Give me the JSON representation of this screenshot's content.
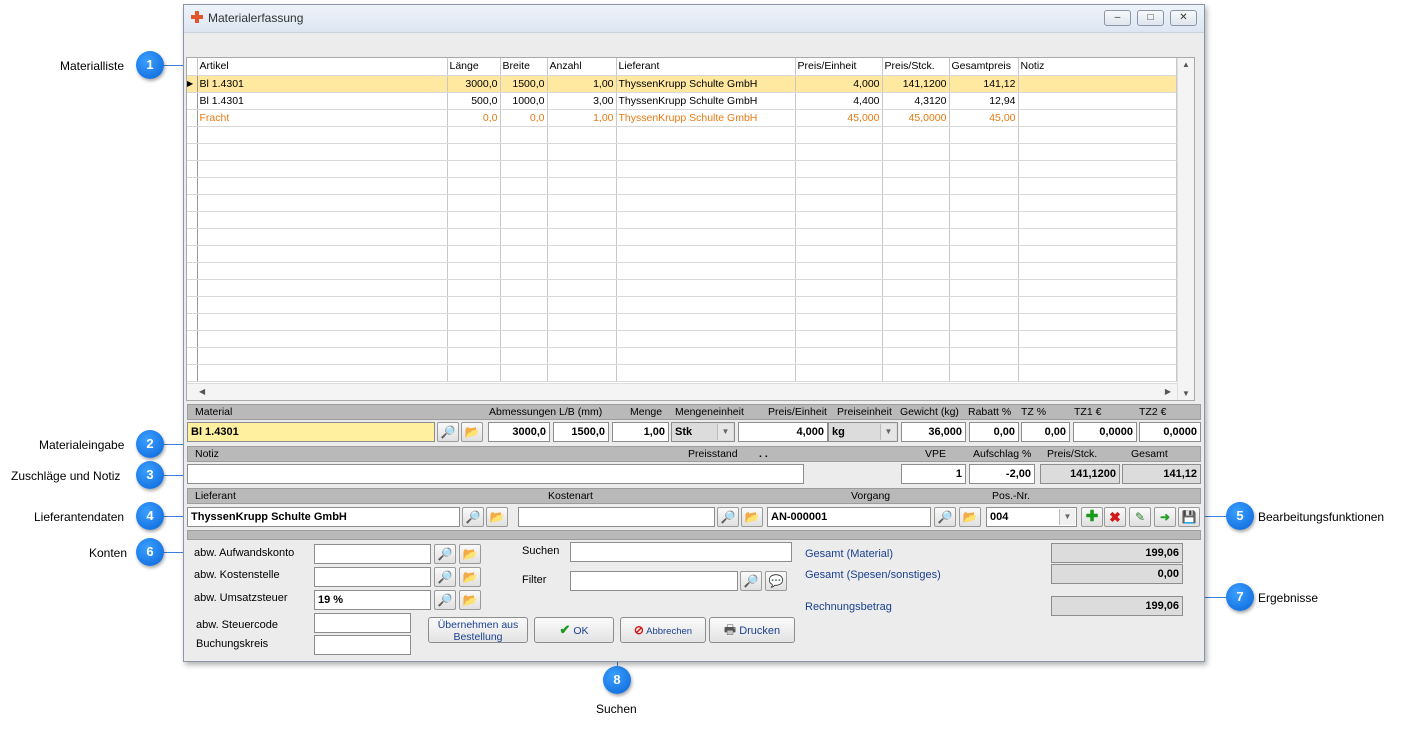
{
  "callouts": {
    "c1": {
      "num": "1",
      "label": "Materialliste"
    },
    "c2": {
      "num": "2",
      "label": "Materialeingabe"
    },
    "c3": {
      "num": "3",
      "label": "Zuschläge und Notiz"
    },
    "c4": {
      "num": "4",
      "label": "Lieferantendaten"
    },
    "c5": {
      "num": "5",
      "label": "Bearbeitungsfunktionen"
    },
    "c6": {
      "num": "6",
      "label": "Konten"
    },
    "c7": {
      "num": "7",
      "label": "Ergebnisse"
    },
    "c8": {
      "num": "8",
      "label": "Suchen"
    }
  },
  "window": {
    "title": "Materialerfassung",
    "buttons": {
      "minimize": "–",
      "maximize": "□",
      "close": "✕"
    }
  },
  "grid": {
    "columns": [
      "Artikel",
      "Länge",
      "Breite",
      "Anzahl",
      "Lieferant",
      "Preis/Einheit",
      "Preis/Stck.",
      "Gesamtpreis",
      "Notiz"
    ],
    "rows": [
      [
        "Bl 1.4301",
        "3000,0",
        "1500,0",
        "1,00",
        "ThyssenKrupp Schulte GmbH",
        "4,000",
        "141,1200",
        "141,12",
        ""
      ],
      [
        "Bl 1.4301",
        "500,0",
        "1000,0",
        "3,00",
        "ThyssenKrupp Schulte GmbH",
        "4,400",
        "4,3120",
        "12,94",
        ""
      ],
      [
        "Fracht",
        "0,0",
        "0,0",
        "1,00",
        "ThyssenKrupp Schulte GmbH",
        "45,000",
        "45,0000",
        "45,00",
        ""
      ]
    ],
    "row_indicator": "▶"
  },
  "material": {
    "headers": {
      "material": "Material",
      "abmessungen": "Abmessungen L/B (mm)",
      "menge": "Menge",
      "mengeneinheit": "Mengeneinheit",
      "preis_einheit": "Preis/Einheit",
      "preiseinheit": "Preiseinheit",
      "gewicht": "Gewicht (kg)",
      "rabatt": "Rabatt %",
      "tz": "TZ %",
      "tz1": "TZ1 €",
      "tz2": "TZ2 €"
    },
    "values": {
      "material": "Bl 1.4301",
      "laenge": "3000,0",
      "breite": "1500,0",
      "menge": "1,00",
      "mengeneinheit": "Stk",
      "preis_einheit": "4,000",
      "preiseinheit": "kg",
      "gewicht": "36,000",
      "rabatt": "0,00",
      "tz": "0,00",
      "tz1": "0,0000",
      "tz2": "0,0000"
    }
  },
  "notiz": {
    "headers": {
      "notiz": "Notiz",
      "preisstand": "Preisstand",
      "preisstand_val": ". .",
      "vpe": "VPE",
      "aufschlag": "Aufschlag %",
      "preis_stck": "Preis/Stck.",
      "gesamt": "Gesamt"
    },
    "values": {
      "notiz": "",
      "vpe": "1",
      "aufschlag": "-2,00",
      "preis_stck": "141,1200",
      "gesamt": "141,12"
    }
  },
  "lieferant": {
    "headers": {
      "lieferant": "Lieferant",
      "kostenart": "Kostenart",
      "vorgang": "Vorgang",
      "pos": "Pos.-Nr."
    },
    "values": {
      "lieferant": "ThyssenKrupp Schulte GmbH",
      "kostenart": "",
      "vorgang": "AN-000001",
      "pos": "004"
    }
  },
  "konten": {
    "aufwandskonto": "abw. Aufwandskonto",
    "kostenstelle": "abw. Kostenstelle",
    "umsatzsteuer": "abw. Umsatzsteuer",
    "umsatzsteuer_val": "19 %",
    "steuercode": "abw. Steuercode",
    "buchungskreis": "Buchungskreis"
  },
  "suche": {
    "suchen": "Suchen",
    "filter": "Filter"
  },
  "buttons": {
    "uebernehmen": "Übernehmen aus Bestellung",
    "ok": "OK",
    "abbrechen": "Abbrechen",
    "drucken": "Drucken"
  },
  "ergebnisse": {
    "gesamt_material": "Gesamt (Material)",
    "gesamt_material_val": "199,06",
    "gesamt_spesen": "Gesamt (Spesen/sonstiges)",
    "gesamt_spesen_val": "0,00",
    "rechnungsbetrag": "Rechnungsbetrag",
    "rechnungsbetrag_val": "199,06"
  },
  "colors": {
    "accent_blue": "#0a64d8",
    "selected_row": "#ffe8a0",
    "orange_text": "#e87a10",
    "label_blue": "#1a3f8f"
  },
  "icons": {
    "search": "magnifier-icon",
    "folder": "folder-icon",
    "add": "plus-icon",
    "delete": "delete-icon",
    "edit": "edit-icon",
    "apply": "arrow-right-icon",
    "save": "save-icon",
    "print": "printer-icon"
  }
}
